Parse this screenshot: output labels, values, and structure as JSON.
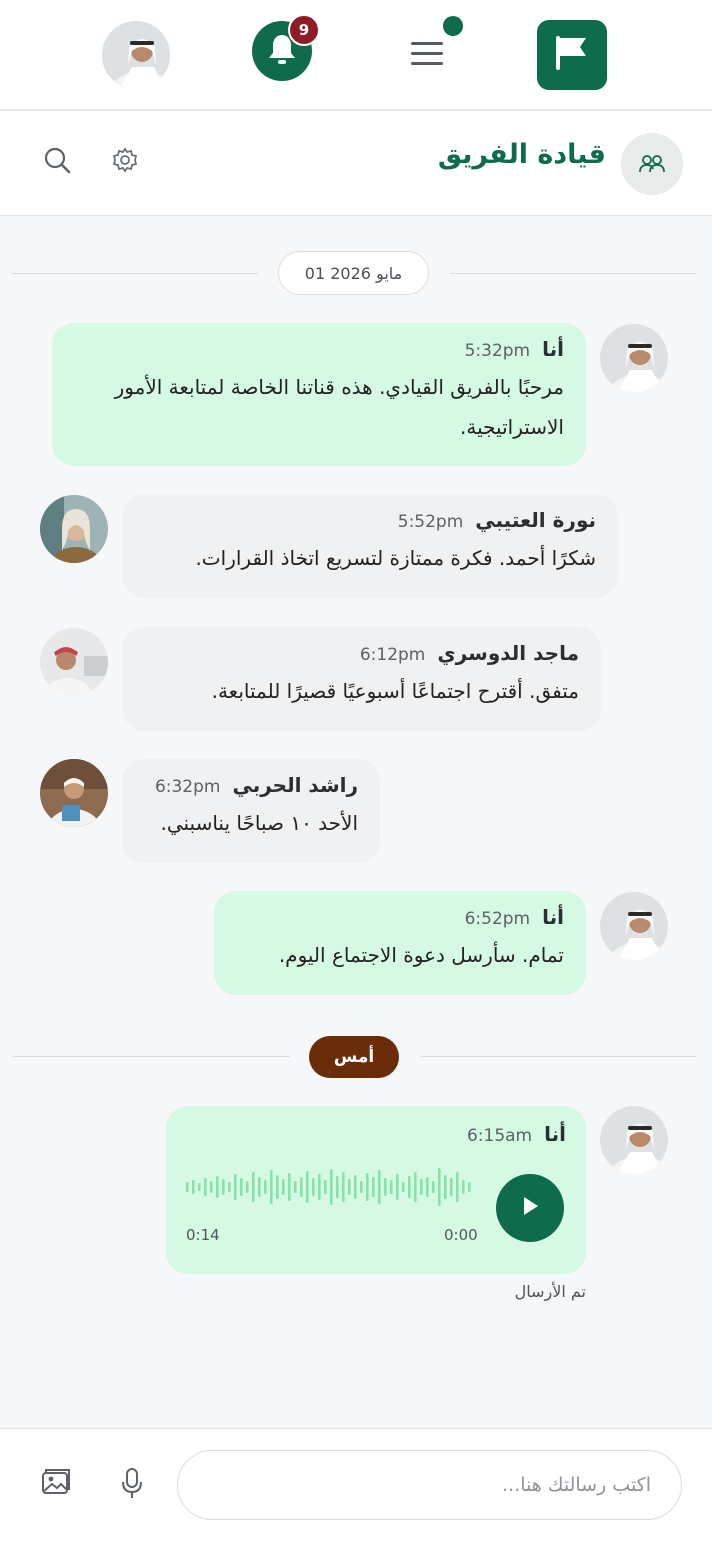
{
  "topbar": {
    "notifications_count": "9",
    "icons": [
      "avatar",
      "bell-icon",
      "menu-icon",
      "flag-icon"
    ]
  },
  "channel": {
    "title": "قيادة الفريق",
    "icons": [
      "team-icon",
      "gear-icon",
      "search-icon"
    ]
  },
  "date_separator": "مايو 2026 01",
  "yesterday_label": "أمس",
  "messages": [
    {
      "sender": "أنا",
      "time": "5:32pm",
      "text": "مرحبًا بالفريق القيادي. هذه قناتنا الخاصة لمتابعة الأمور الاستراتيجية.",
      "mine": true
    },
    {
      "sender": "نورة العتيبي",
      "time": "5:52pm",
      "text": "شكرًا أحمد. فكرة ممتازة لتسريع اتخاذ القرارات.",
      "mine": false
    },
    {
      "sender": "ماجد الدوسري",
      "time": "6:12pm",
      "text": "متفق. أقترح اجتماعًا أسبوعيًا قصيرًا للمتابعة.",
      "mine": false
    },
    {
      "sender": "راشد الحربي",
      "time": "6:32pm",
      "text": "الأحد ١٠ صباحًا يناسبني.",
      "mine": false
    },
    {
      "sender": "أنا",
      "time": "6:52pm",
      "text": "تمام. سأرسل دعوة الاجتماع اليوم.",
      "mine": true
    }
  ],
  "voice_note": {
    "sender": "أنا",
    "time": "6:15am",
    "elapsed": "0:00",
    "duration": "0:14",
    "status": "تم الأرسال"
  },
  "composer": {
    "placeholder": "اكتب رسالتك هنا...",
    "icons": [
      "microphone-icon",
      "image-icon"
    ]
  },
  "colors": {
    "brand": "#0e6b4c",
    "badge": "#8e1d25",
    "yesterday_pill": "#6b2c0a",
    "my_bubble": "#d6f9e3",
    "other_bubble": "#eff1f3",
    "waveform": "#86e3ab"
  }
}
